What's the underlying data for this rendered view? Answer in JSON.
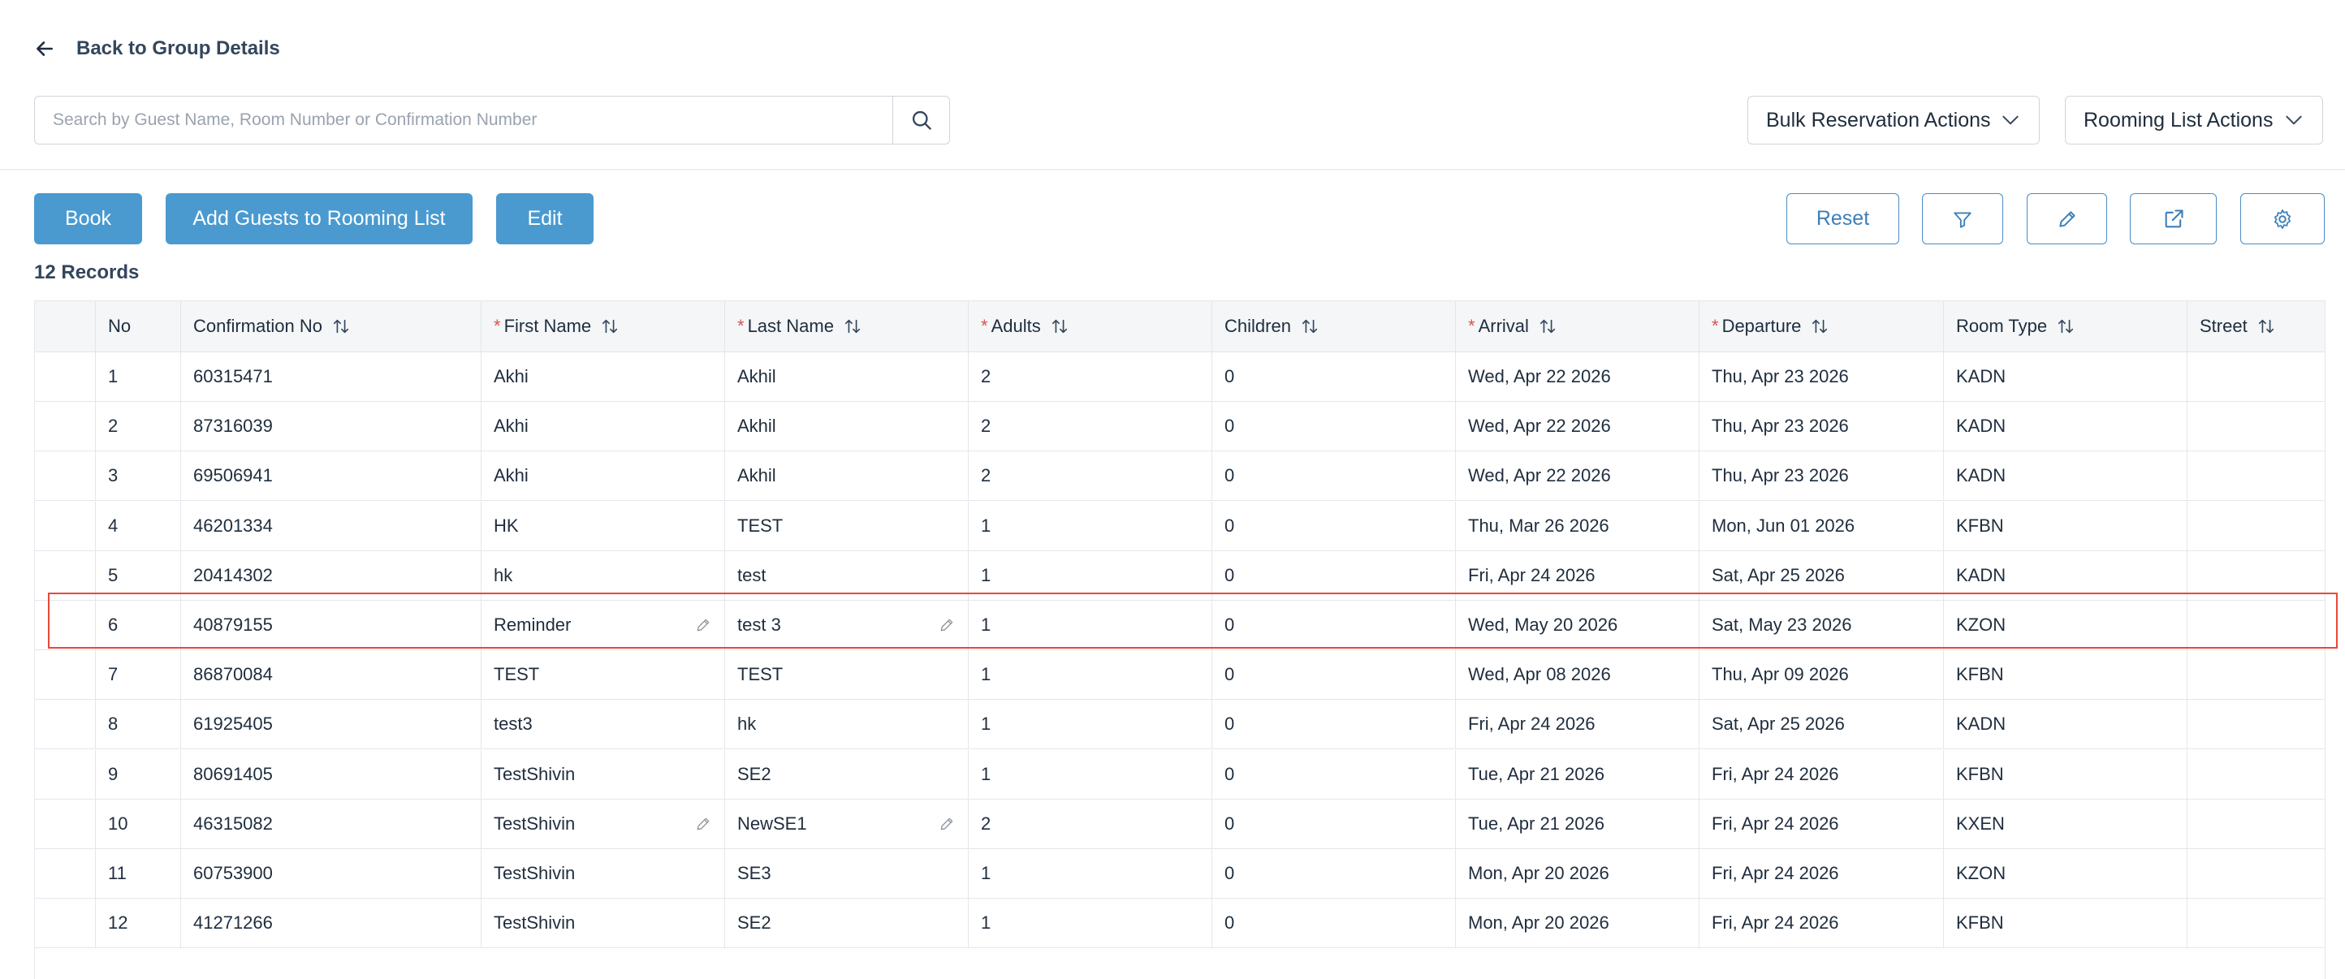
{
  "nav": {
    "back_label": "Back to Group Details"
  },
  "search": {
    "placeholder": "Search by Guest Name, Room Number or Confirmation Number",
    "value": ""
  },
  "dropdowns": {
    "bulk_label": "Bulk Reservation Actions",
    "rooming_label": "Rooming List Actions"
  },
  "actions": {
    "book_label": "Book",
    "add_guests_label": "Add Guests to Rooming List",
    "edit_label": "Edit",
    "reset_label": "Reset"
  },
  "records_count": "12 Records",
  "table": {
    "columns": [
      {
        "label": "No",
        "required": false,
        "sortable": false
      },
      {
        "label": "Confirmation No",
        "required": false,
        "sortable": true
      },
      {
        "label": "First Name",
        "required": true,
        "sortable": true
      },
      {
        "label": "Last Name",
        "required": true,
        "sortable": true
      },
      {
        "label": "Adults",
        "required": true,
        "sortable": true
      },
      {
        "label": "Children",
        "required": false,
        "sortable": true
      },
      {
        "label": "Arrival",
        "required": true,
        "sortable": true
      },
      {
        "label": "Departure",
        "required": true,
        "sortable": true
      },
      {
        "label": "Room Type",
        "required": false,
        "sortable": true
      },
      {
        "label": "Street",
        "required": false,
        "sortable": true
      }
    ],
    "rows": [
      {
        "no": "1",
        "conf": "60315471",
        "first": "Akhi",
        "last": "Akhil",
        "adults": "2",
        "children": "0",
        "arrival": "Wed, Apr 22 2026",
        "departure": "Thu, Apr 23 2026",
        "room_type": "KADN",
        "street": "",
        "editable": false,
        "highlighted": false
      },
      {
        "no": "2",
        "conf": "87316039",
        "first": "Akhi",
        "last": "Akhil",
        "adults": "2",
        "children": "0",
        "arrival": "Wed, Apr 22 2026",
        "departure": "Thu, Apr 23 2026",
        "room_type": "KADN",
        "street": "",
        "editable": false,
        "highlighted": false
      },
      {
        "no": "3",
        "conf": "69506941",
        "first": "Akhi",
        "last": "Akhil",
        "adults": "2",
        "children": "0",
        "arrival": "Wed, Apr 22 2026",
        "departure": "Thu, Apr 23 2026",
        "room_type": "KADN",
        "street": "",
        "editable": false,
        "highlighted": false
      },
      {
        "no": "4",
        "conf": "46201334",
        "first": "HK",
        "last": "TEST",
        "adults": "1",
        "children": "0",
        "arrival": "Thu, Mar 26 2026",
        "departure": "Mon, Jun 01 2026",
        "room_type": "KFBN",
        "street": "",
        "editable": false,
        "highlighted": false
      },
      {
        "no": "5",
        "conf": "20414302",
        "first": "hk",
        "last": "test",
        "adults": "1",
        "children": "0",
        "arrival": "Fri, Apr 24 2026",
        "departure": "Sat, Apr 25 2026",
        "room_type": "KADN",
        "street": "",
        "editable": false,
        "highlighted": false
      },
      {
        "no": "6",
        "conf": "40879155",
        "first": "Reminder",
        "last": "test 3",
        "adults": "1",
        "children": "0",
        "arrival": "Wed, May 20 2026",
        "departure": "Sat, May 23 2026",
        "room_type": "KZON",
        "street": "",
        "editable": true,
        "highlighted": true
      },
      {
        "no": "7",
        "conf": "86870084",
        "first": "TEST",
        "last": "TEST",
        "adults": "1",
        "children": "0",
        "arrival": "Wed, Apr 08 2026",
        "departure": "Thu, Apr 09 2026",
        "room_type": "KFBN",
        "street": "",
        "editable": false,
        "highlighted": false
      },
      {
        "no": "8",
        "conf": "61925405",
        "first": "test3",
        "last": "hk",
        "adults": "1",
        "children": "0",
        "arrival": "Fri, Apr 24 2026",
        "departure": "Sat, Apr 25 2026",
        "room_type": "KADN",
        "street": "",
        "editable": false,
        "highlighted": false
      },
      {
        "no": "9",
        "conf": "80691405",
        "first": "TestShivin",
        "last": "SE2",
        "adults": "1",
        "children": "0",
        "arrival": "Tue, Apr 21 2026",
        "departure": "Fri, Apr 24 2026",
        "room_type": "KFBN",
        "street": "",
        "editable": false,
        "highlighted": false
      },
      {
        "no": "10",
        "conf": "46315082",
        "first": "TestShivin",
        "last": "NewSE1",
        "adults": "2",
        "children": "0",
        "arrival": "Tue, Apr 21 2026",
        "departure": "Fri, Apr 24 2026",
        "room_type": "KXEN",
        "street": "",
        "editable": true,
        "highlighted": false
      },
      {
        "no": "11",
        "conf": "60753900",
        "first": "TestShivin",
        "last": "SE3",
        "adults": "1",
        "children": "0",
        "arrival": "Mon, Apr 20 2026",
        "departure": "Fri, Apr 24 2026",
        "room_type": "KZON",
        "street": "",
        "editable": false,
        "highlighted": false
      },
      {
        "no": "12",
        "conf": "41271266",
        "first": "TestShivin",
        "last": "SE2",
        "adults": "1",
        "children": "0",
        "arrival": "Mon, Apr 20 2026",
        "departure": "Fri, Apr 24 2026",
        "room_type": "KFBN",
        "street": "",
        "editable": false,
        "highlighted": false
      }
    ]
  },
  "colors": {
    "primary": "#4a9ad0",
    "outline": "#4a8cc4",
    "required": "#d9534f",
    "highlight": "#e8483a",
    "header_bg": "#f4f6f8"
  },
  "icons": {
    "back": "arrow-left-icon",
    "search": "search-icon",
    "dropdown": "chevron-down-icon",
    "filter": "filter-icon",
    "edit": "pencil-icon",
    "export": "external-link-icon",
    "settings": "gear-icon",
    "sort": "sort-arrows-icon",
    "cell_edit": "pencil-icon"
  }
}
